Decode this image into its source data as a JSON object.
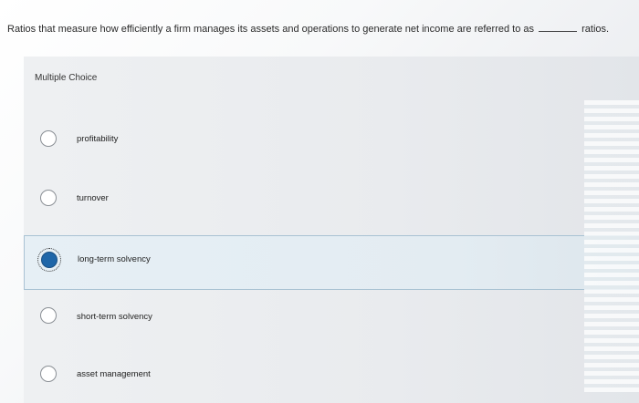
{
  "question": {
    "text": "Ratios that measure how efficiently a firm manages its assets and operations to generate net income are referred to as",
    "suffix": "ratios."
  },
  "section": {
    "label": "Multiple Choice"
  },
  "options": [
    {
      "label": "profitability",
      "selected": false
    },
    {
      "label": "turnover",
      "selected": false
    },
    {
      "label": "long-term solvency",
      "selected": true
    },
    {
      "label": "short-term solvency",
      "selected": false
    },
    {
      "label": "asset management",
      "selected": false
    }
  ],
  "colors": {
    "selected_radio": "#1f66a8",
    "selected_row_border": "#a9c2d3"
  }
}
